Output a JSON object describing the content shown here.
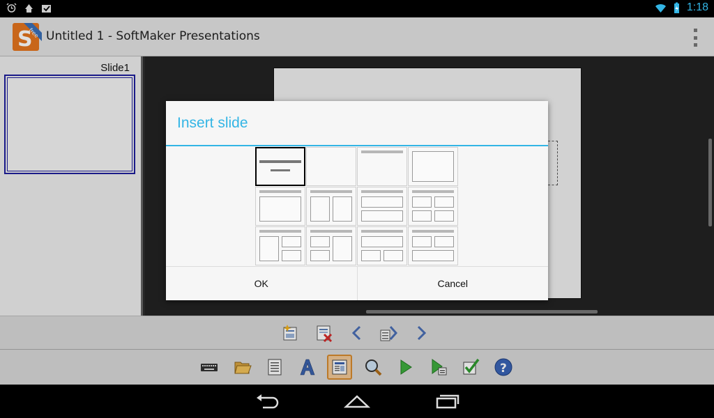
{
  "status_bar": {
    "time": "1:18",
    "left_icons": [
      "alarm-icon",
      "download-icon",
      "task-icon"
    ],
    "right_icons": [
      "wifi-icon",
      "battery-charging-icon"
    ]
  },
  "action_bar": {
    "title": "Untitled 1 - SoftMaker Presentations",
    "logo_badge": "free",
    "logo_letter": "S",
    "menu_icon": "overflow-menu-icon"
  },
  "slide_panel": {
    "slides": [
      {
        "label": "Slide1",
        "selected": true
      }
    ]
  },
  "dialog": {
    "title": "Insert slide",
    "ok_label": "OK",
    "cancel_label": "Cancel",
    "layouts": [
      "title-slide",
      "blank",
      "title-only",
      "content-only",
      "title-content",
      "title-two-content",
      "title-two-rows",
      "title-four-content",
      "title-content-two-right",
      "title-two-left-content",
      "title-content-two-bottom",
      "title-two-top-content"
    ],
    "selected_layout_index": 0
  },
  "slide_toolbar": {
    "icons": [
      "insert-slide-icon",
      "delete-slide-icon",
      "previous-slide-icon",
      "slide-layout-icon",
      "next-slide-icon"
    ]
  },
  "main_toolbar": {
    "icons": [
      "keyboard-icon",
      "open-folder-icon",
      "document-icon",
      "font-icon",
      "slide-view-icon",
      "zoom-icon",
      "play-icon",
      "play-from-current-icon",
      "check-icon",
      "help-icon"
    ],
    "active_index": 4
  },
  "nav_bar": {
    "icons": [
      "back-icon",
      "home-icon",
      "recent-apps-icon"
    ]
  },
  "colors": {
    "accent": "#33b5e5",
    "selection": "#1e1e9c",
    "toolbar_active": "#f2c998"
  }
}
